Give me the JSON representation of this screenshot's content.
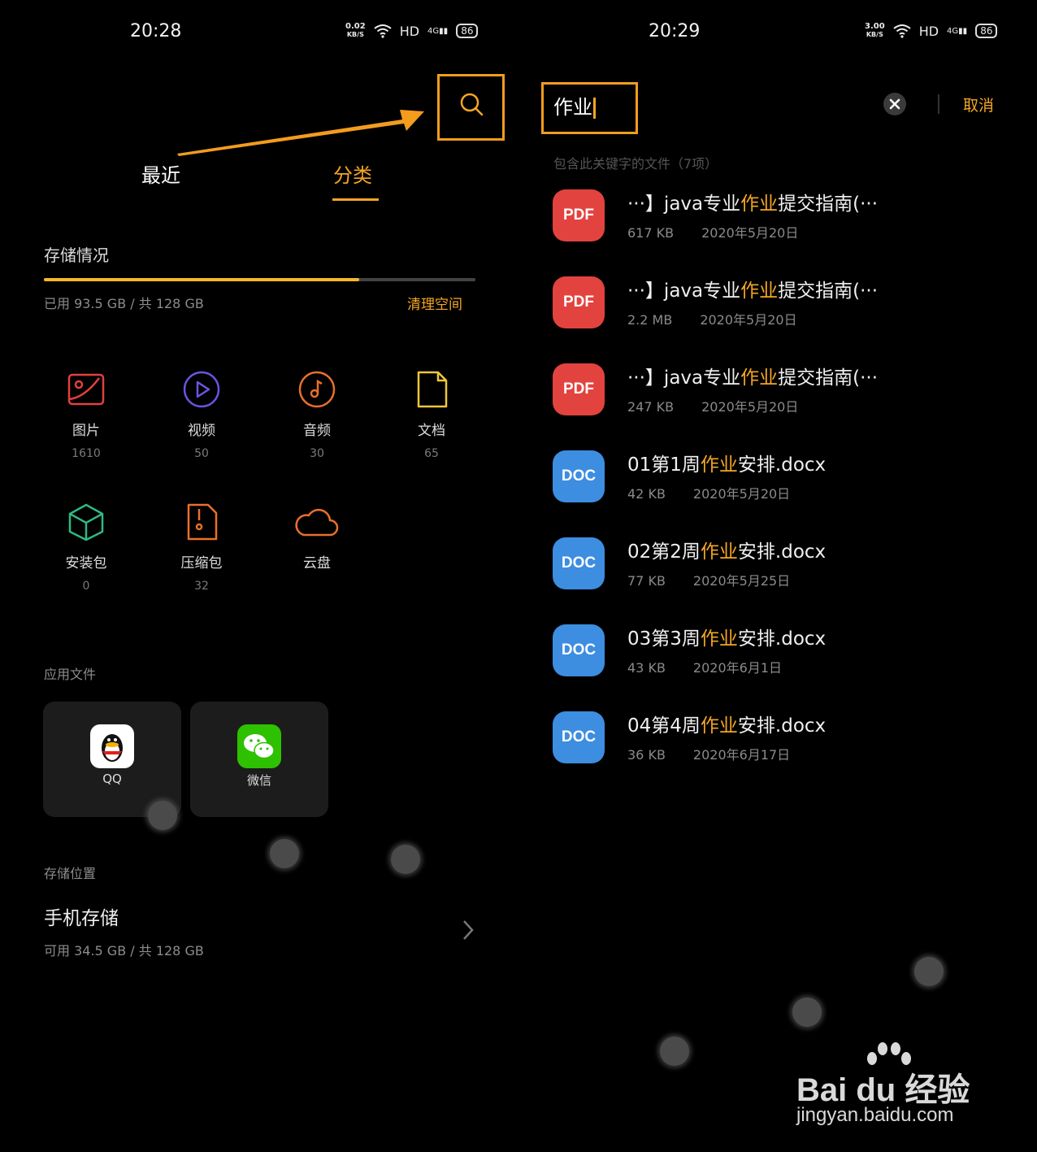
{
  "left": {
    "status": {
      "time": "20:28",
      "speed": "0.02",
      "speed_unit": "KB/S",
      "wifi": "wifi-icon",
      "hd": "HD",
      "signal": "4G",
      "battery": "86"
    },
    "tabs": [
      {
        "label": "最近"
      },
      {
        "label": "分类"
      }
    ],
    "storage": {
      "title": "存储情况",
      "used_text": "已用 93.5 GB / 共 128 GB",
      "used_fraction": 0.73,
      "clean_label": "清理空间"
    },
    "categories": [
      {
        "label": "图片",
        "count": "1610",
        "icon": "image-icon"
      },
      {
        "label": "视频",
        "count": "50",
        "icon": "video-icon"
      },
      {
        "label": "音频",
        "count": "30",
        "icon": "music-icon"
      },
      {
        "label": "文档",
        "count": "65",
        "icon": "document-icon"
      },
      {
        "label": "安装包",
        "count": "0",
        "icon": "package-icon"
      },
      {
        "label": "压缩包",
        "count": "32",
        "icon": "archive-icon"
      },
      {
        "label": "云盘",
        "count": "",
        "icon": "cloud-icon"
      }
    ],
    "app_files": {
      "title": "应用文件",
      "apps": [
        {
          "label": "QQ",
          "icon": "qq-icon"
        },
        {
          "label": "微信",
          "icon": "wechat-icon"
        }
      ]
    },
    "storage_location": {
      "title": "存储位置",
      "name": "手机存储",
      "detail": "可用 34.5 GB / 共 128 GB"
    }
  },
  "right": {
    "status": {
      "time": "20:29",
      "speed": "3.00",
      "speed_unit": "KB/S",
      "hd": "HD",
      "signal": "4G",
      "battery": "86"
    },
    "search": {
      "query": "作业",
      "cancel_label": "取消"
    },
    "result_header": "包含此关键字的文件（7项）",
    "keyword_color": "#f5a623",
    "files": [
      {
        "type": "PDF",
        "pre": "···】java专业",
        "kw": "作业",
        "post": "提交指南(···",
        "size": "617 KB",
        "date": "2020年5月20日"
      },
      {
        "type": "PDF",
        "pre": "···】java专业",
        "kw": "作业",
        "post": "提交指南(···",
        "size": "2.2 MB",
        "date": "2020年5月20日"
      },
      {
        "type": "PDF",
        "pre": "···】java专业",
        "kw": "作业",
        "post": "提交指南(···",
        "size": "247 KB",
        "date": "2020年5月20日"
      },
      {
        "type": "DOC",
        "pre": "01第1周",
        "kw": "作业",
        "post": "安排.docx",
        "size": "42 KB",
        "date": "2020年5月20日"
      },
      {
        "type": "DOC",
        "pre": "02第2周",
        "kw": "作业",
        "post": "安排.docx",
        "size": "77 KB",
        "date": "2020年5月25日"
      },
      {
        "type": "DOC",
        "pre": "03第3周",
        "kw": "作业",
        "post": "安排.docx",
        "size": "43 KB",
        "date": "2020年6月1日"
      },
      {
        "type": "DOC",
        "pre": "04第4周",
        "kw": "作业",
        "post": "安排.docx",
        "size": "36 KB",
        "date": "2020年6月17日"
      }
    ]
  },
  "watermark": {
    "brand": "Bai du 经验",
    "url": "jingyan.baidu.com"
  }
}
